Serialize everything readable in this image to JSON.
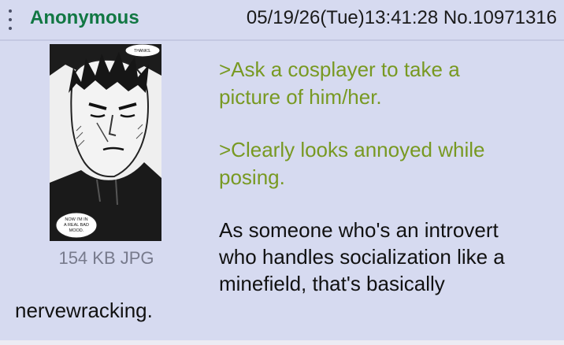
{
  "post": {
    "name": "Anonymous",
    "datetime": "05/19/26(Tue)13:41:28",
    "post_no": "No.10971316",
    "image": {
      "thanks_text": "THANKS.",
      "caption_text": "NOW I'M IN A REAL BAD MOOD.",
      "file_info": "154 KB JPG"
    },
    "greentext": [
      [
        "&gt;Ask a cosplayer to take a",
        "picture of him/her."
      ],
      [
        "&gt;Clearly looks annoyed while",
        "posing."
      ]
    ],
    "greentext_plain": [
      [
        ">Ask a cosplayer to take a",
        "picture of him/her."
      ],
      [
        ">Clearly looks annoyed while",
        "posing."
      ]
    ],
    "body_lines": [
      "As someone who's an introvert",
      "who handles socialization like a",
      "minefield, that's basically",
      "nervewracking."
    ]
  },
  "colors": {
    "background": "#d6daf0",
    "name": "#117743",
    "greentext": "#789922",
    "file_info": "#777a8c"
  },
  "icons": [
    "vertical-ellipsis-menu-icon"
  ]
}
